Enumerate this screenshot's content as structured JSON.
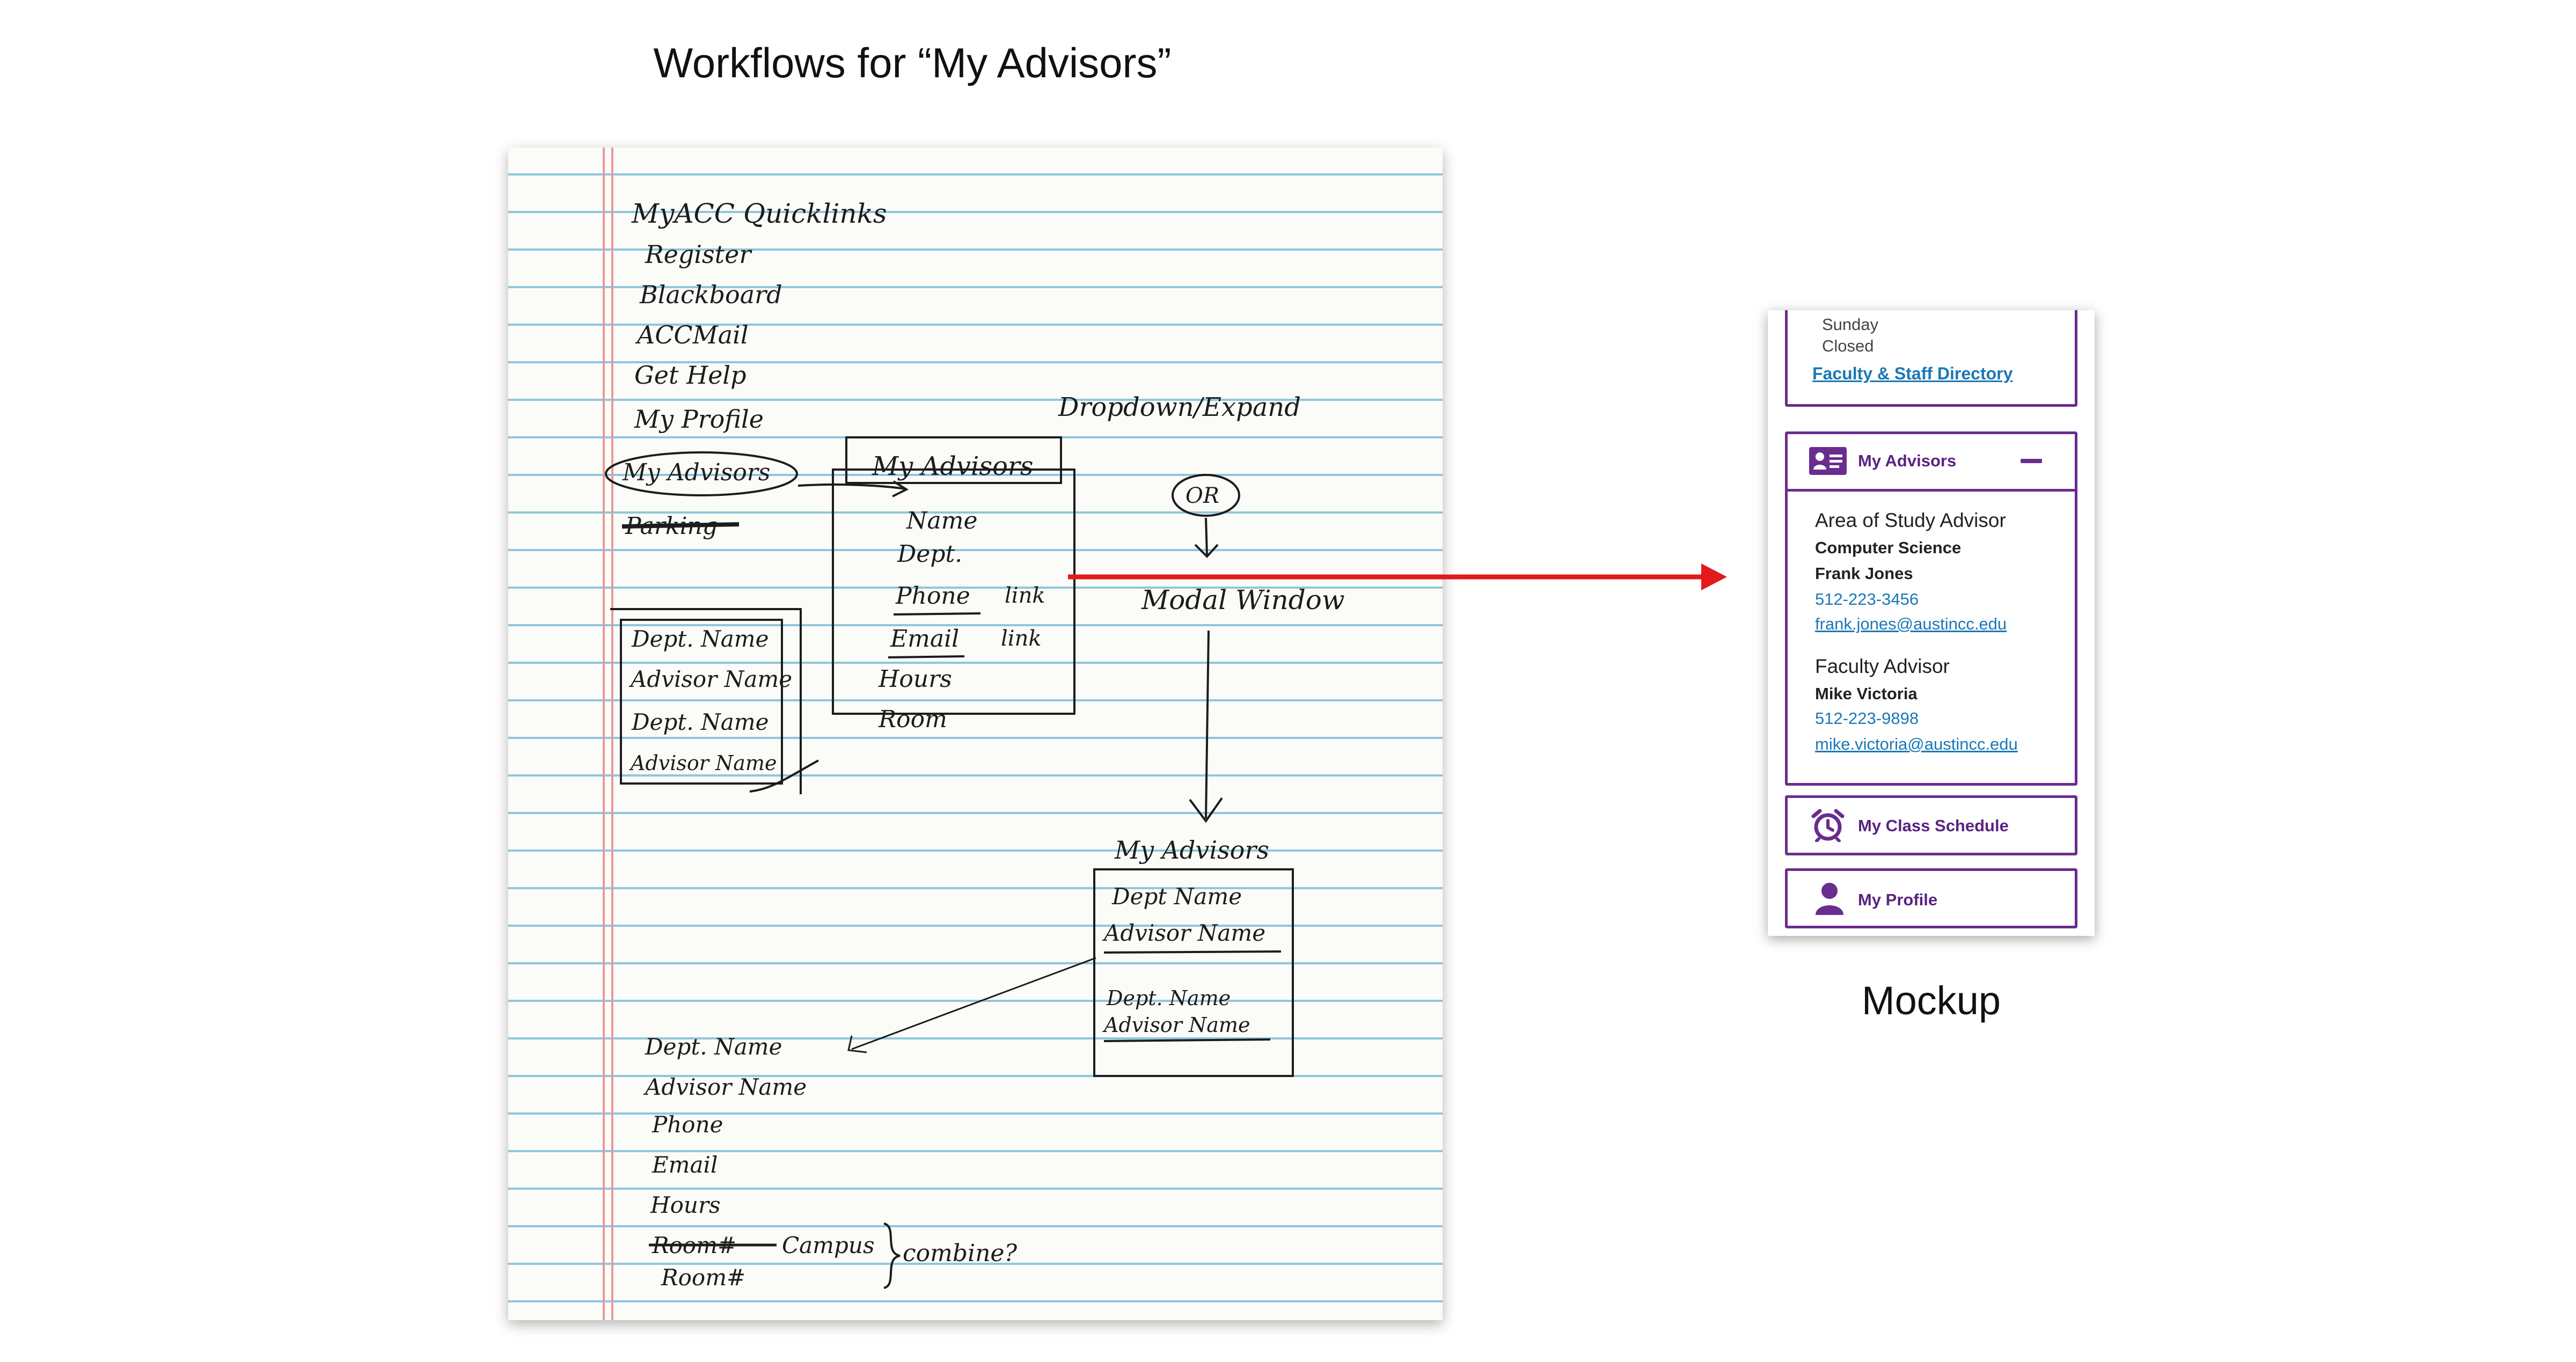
{
  "title": "Workflows for “My Advisors”",
  "sketch": {
    "quicklinks_title": "MyACC Quicklinks",
    "quicklinks": [
      "Register",
      "Blackboard",
      "ACCMail",
      "Get Help",
      "My Profile",
      "My Advisors",
      "Parking"
    ],
    "dropdown_note": "Dropdown/Expand",
    "or_note": "OR",
    "modal_note": "Modal Window",
    "expand_box": {
      "title": "My Advisors",
      "fields": [
        "Name",
        "Dept.",
        "Phone",
        "Email",
        "Hours",
        "Room"
      ],
      "link_note": "link"
    },
    "left_list": [
      "Dept. Name",
      "Advisor Name",
      "Dept. Name",
      "Advisor Name"
    ],
    "modal_box": {
      "title": "My Advisors",
      "lines": [
        "Dept Name",
        "Advisor Name",
        "Dept. Name",
        "Advisor Name"
      ]
    },
    "detail_list": [
      "Dept. Name",
      "Advisor Name",
      "Phone",
      "Email",
      "Hours",
      "Room#",
      "Campus",
      "Room#"
    ],
    "combine_note": "combine?"
  },
  "mockup": {
    "hours_day": "Sunday",
    "hours_status": "Closed",
    "directory_link": "Faculty & Staff Directory",
    "advisors_header": "My Advisors",
    "collapse_icon": "minus-icon",
    "advisors": [
      {
        "role": "Area of Study Advisor",
        "dept": "Computer Science",
        "name": "Frank Jones",
        "phone": "512-223-3456",
        "email": "frank.jones@austincc.edu"
      },
      {
        "role": "Faculty Advisor",
        "name": "Mike Victoria",
        "phone": "512-223-9898",
        "email": "mike.victoria@austincc.edu"
      }
    ],
    "schedule_label": "My Class Schedule",
    "profile_label": "My Profile",
    "caption": "Mockup"
  },
  "colors": {
    "accent": "#6a2c8f",
    "link": "#1b78b4",
    "arrow": "#e21a1a",
    "ruling": "#8fc6dc",
    "margin": "#e89a9a"
  }
}
